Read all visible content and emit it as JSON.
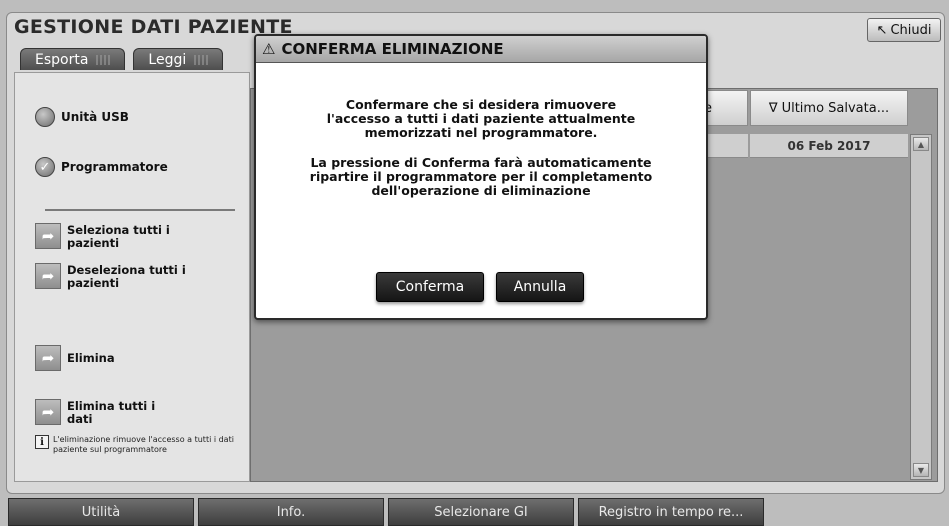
{
  "window": {
    "title": "GESTIONE DATI PAZIENTE",
    "close_label": "Chiudi"
  },
  "tabs": [
    {
      "label": "Esporta"
    },
    {
      "label": "Leggi"
    }
  ],
  "left_panel": {
    "radios": [
      {
        "label": "Unità USB",
        "selected": false
      },
      {
        "label": "Programmatore",
        "selected": true
      }
    ],
    "actions": {
      "select_all": "Seleziona tutti i pazienti",
      "deselect_all": "Deseleziona tutti i pazienti",
      "delete": "Elimina",
      "delete_all": "Elimina tutti i dati"
    },
    "info_text": "L'eliminazione rimuove l'accesso a tutti i dati paziente sul programmatore"
  },
  "table": {
    "columns": [
      {
        "label": "erie"
      },
      {
        "label": "Ultimo Salvata...",
        "sort_icon": "∇"
      }
    ],
    "rows": [
      {
        "serie": "",
        "last_saved": "06 Feb 2017"
      }
    ]
  },
  "dialog": {
    "title": "CONFERMA ELIMINAZIONE",
    "paragraph1": "Confermare che si desidera rimuovere l'accesso a tutti i dati paziente attualmente memorizzati nel programmatore.",
    "paragraph2": "La pressione di Conferma farà automaticamente ripartire il programmatore per il completamento dell'operazione di eliminazione",
    "confirm_label": "Conferma",
    "cancel_label": "Annulla"
  },
  "bottom_bar": [
    {
      "label": "Utilità"
    },
    {
      "label": "Info."
    },
    {
      "label": "Selezionare GI"
    },
    {
      "label": "Registro in tempo re..."
    }
  ]
}
